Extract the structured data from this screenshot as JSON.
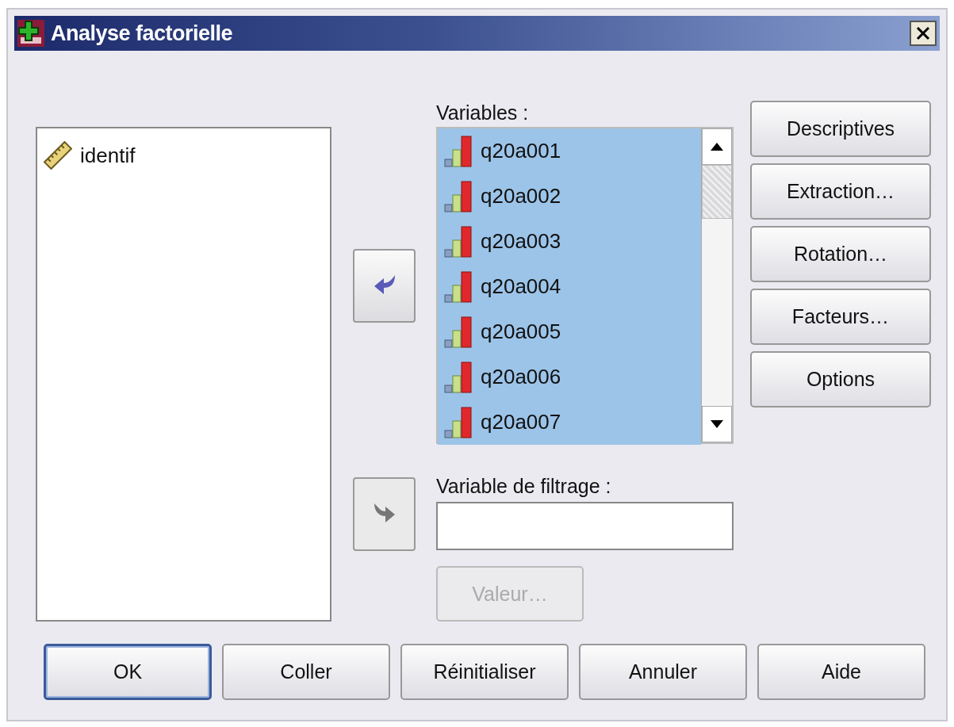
{
  "window": {
    "title": "Analyse factorielle"
  },
  "source_list": {
    "items": [
      {
        "label": "identif",
        "selected": false
      }
    ]
  },
  "move_buttons": [
    {
      "disabled": false
    },
    {
      "disabled": true
    }
  ],
  "variables": {
    "label": "Variables :",
    "items": [
      {
        "label": "q20a001",
        "selected": true
      },
      {
        "label": "q20a002",
        "selected": true
      },
      {
        "label": "q20a003",
        "selected": true
      },
      {
        "label": "q20a004",
        "selected": true
      },
      {
        "label": "q20a005",
        "selected": true
      },
      {
        "label": "q20a006",
        "selected": true
      },
      {
        "label": "q20a007",
        "selected": true
      }
    ]
  },
  "filter": {
    "label": "Variable de filtrage :",
    "value_button": {
      "label": "Valeur…",
      "disabled": true
    }
  },
  "side_buttons": [
    {
      "label": "Descriptives"
    },
    {
      "label": "Extraction…"
    },
    {
      "label": "Rotation…"
    },
    {
      "label": "Facteurs…"
    },
    {
      "label": "Options"
    }
  ],
  "bottom_buttons": [
    {
      "label": "OK",
      "default": true
    },
    {
      "label": "Coller",
      "default": false
    },
    {
      "label": "Réinitialiser",
      "default": false
    },
    {
      "label": "Annuler",
      "default": false
    },
    {
      "label": "Aide",
      "default": false
    }
  ]
}
